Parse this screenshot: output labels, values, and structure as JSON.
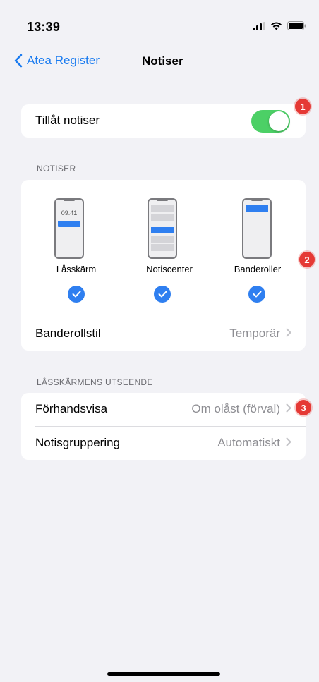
{
  "status": {
    "time": "13:39"
  },
  "nav": {
    "back_label": "Atea Register",
    "title": "Notiser"
  },
  "allow": {
    "label": "Tillåt notiser",
    "enabled": true
  },
  "notiser_section": {
    "header": "NOTISER",
    "styles": [
      {
        "label": "Låsskärm",
        "preview_time": "09:41",
        "checked": true
      },
      {
        "label": "Notiscenter",
        "checked": true
      },
      {
        "label": "Banderoller",
        "checked": true
      }
    ],
    "banner_style": {
      "label": "Banderollstil",
      "value": "Temporär"
    }
  },
  "lockscreen_section": {
    "header": "LÅSSKÄRMENS UTSEENDE",
    "rows": [
      {
        "label": "Förhandsvisa",
        "value": "Om olåst (förval)"
      },
      {
        "label": "Notisgruppering",
        "value": "Automatiskt"
      }
    ]
  },
  "badges": [
    "1",
    "2",
    "3"
  ],
  "colors": {
    "accent": "#1b7cf0",
    "toggle_on": "#4cd066",
    "badge": "#e53935"
  },
  "icons": [
    "signal-icon",
    "wifi-icon",
    "battery-icon",
    "chevron-left-icon",
    "chevron-right-icon",
    "checkmark-icon"
  ]
}
